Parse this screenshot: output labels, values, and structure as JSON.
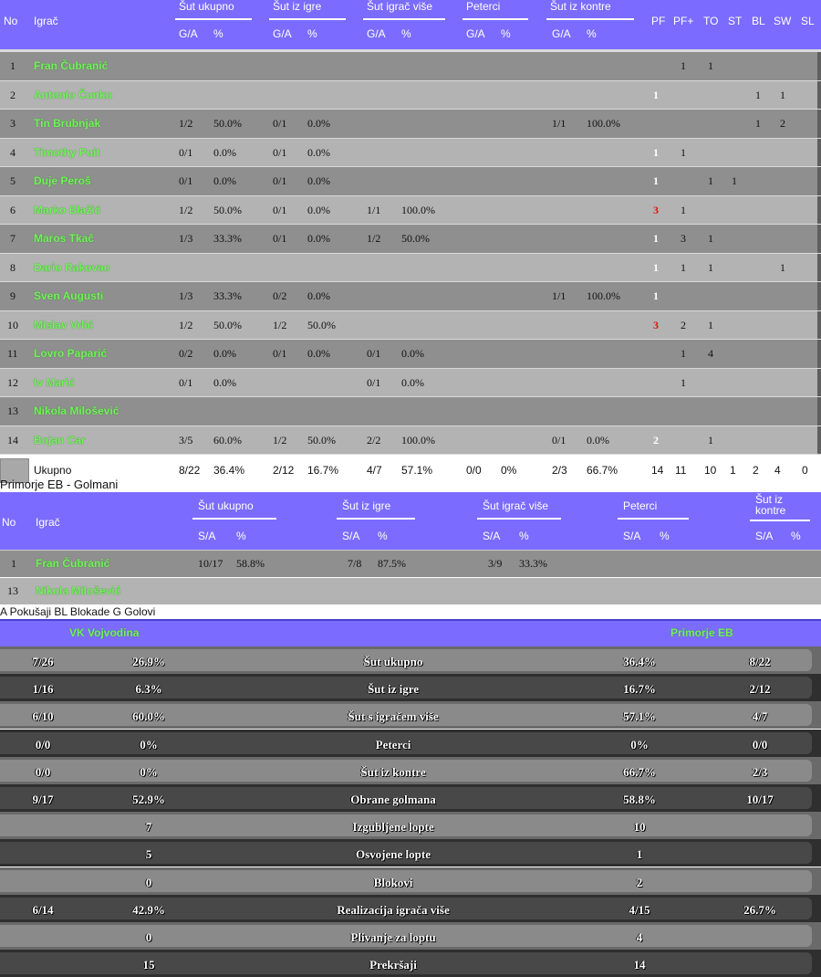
{
  "player_table": {
    "headers": {
      "no": "No",
      "player": "Igrač",
      "groups": [
        "Šut ukupno",
        "Šut iz igre",
        "Šut igrač više",
        "Peterci",
        "Šut iz kontre"
      ],
      "sub_ga": "G/A",
      "sub_pct": "%",
      "extra": [
        "PF",
        "PF+",
        "TO",
        "ST",
        "BL",
        "SW",
        "SL"
      ]
    },
    "rows": [
      {
        "no": "1",
        "name": "Fran Čubranić",
        "total_ga": "",
        "total_pct": "",
        "field_ga": "",
        "field_pct": "",
        "pp_ga": "",
        "pp_pct": "",
        "pen_ga": "",
        "pen_pct": "",
        "ca_ga": "",
        "ca_pct": "",
        "pf": "",
        "pfp": "1",
        "to": "1",
        "st": "",
        "bl": "",
        "sw": "",
        "sl": ""
      },
      {
        "no": "2",
        "name": "Antonio Čunko",
        "total_ga": "",
        "total_pct": "",
        "field_ga": "",
        "field_pct": "",
        "pp_ga": "",
        "pp_pct": "",
        "pen_ga": "",
        "pen_pct": "",
        "ca_ga": "",
        "ca_pct": "",
        "pf": "1",
        "pfp": "",
        "to": "",
        "st": "",
        "bl": "1",
        "sw": "1",
        "sl": ""
      },
      {
        "no": "3",
        "name": "Tin Brubnjak",
        "total_ga": "1/2",
        "total_pct": "50.0%",
        "field_ga": "0/1",
        "field_pct": "0.0%",
        "pp_ga": "",
        "pp_pct": "",
        "pen_ga": "",
        "pen_pct": "",
        "ca_ga": "1/1",
        "ca_pct": "100.0%",
        "pf": "",
        "pfp": "",
        "to": "",
        "st": "",
        "bl": "1",
        "sw": "2",
        "sl": ""
      },
      {
        "no": "4",
        "name": "Timothy Puit",
        "total_ga": "0/1",
        "total_pct": "0.0%",
        "field_ga": "0/1",
        "field_pct": "0.0%",
        "pp_ga": "",
        "pp_pct": "",
        "pen_ga": "",
        "pen_pct": "",
        "ca_ga": "",
        "ca_pct": "",
        "pf": "1",
        "pfp": "1",
        "to": "",
        "st": "",
        "bl": "",
        "sw": "",
        "sl": ""
      },
      {
        "no": "5",
        "name": "Duje Peroš",
        "total_ga": "0/1",
        "total_pct": "0.0%",
        "field_ga": "0/1",
        "field_pct": "0.0%",
        "pp_ga": "",
        "pp_pct": "",
        "pen_ga": "",
        "pen_pct": "",
        "ca_ga": "",
        "ca_pct": "",
        "pf": "1",
        "pfp": "",
        "to": "1",
        "st": "1",
        "bl": "",
        "sw": "",
        "sl": ""
      },
      {
        "no": "6",
        "name": "Marko Blažić",
        "total_ga": "1/2",
        "total_pct": "50.0%",
        "field_ga": "0/1",
        "field_pct": "0.0%",
        "pp_ga": "1/1",
        "pp_pct": "100.0%",
        "pen_ga": "",
        "pen_pct": "",
        "ca_ga": "",
        "ca_pct": "",
        "pf": "3",
        "pf_red": true,
        "pfp": "1",
        "to": "",
        "st": "",
        "bl": "",
        "sw": "",
        "sl": ""
      },
      {
        "no": "7",
        "name": "Maros Tkač",
        "total_ga": "1/3",
        "total_pct": "33.3%",
        "field_ga": "0/1",
        "field_pct": "0.0%",
        "pp_ga": "1/2",
        "pp_pct": "50.0%",
        "pen_ga": "",
        "pen_pct": "",
        "ca_ga": "",
        "ca_pct": "",
        "pf": "1",
        "pfp": "3",
        "to": "1",
        "st": "",
        "bl": "",
        "sw": "",
        "sl": ""
      },
      {
        "no": "8",
        "name": "Dario Rakovac",
        "total_ga": "",
        "total_pct": "",
        "field_ga": "",
        "field_pct": "",
        "pp_ga": "",
        "pp_pct": "",
        "pen_ga": "",
        "pen_pct": "",
        "ca_ga": "",
        "ca_pct": "",
        "pf": "1",
        "pfp": "1",
        "to": "1",
        "st": "",
        "bl": "",
        "sw": "1",
        "sl": ""
      },
      {
        "no": "9",
        "name": "Sven Augusti",
        "total_ga": "1/3",
        "total_pct": "33.3%",
        "field_ga": "0/2",
        "field_pct": "0.0%",
        "pp_ga": "",
        "pp_pct": "",
        "pen_ga": "",
        "pen_pct": "",
        "ca_ga": "1/1",
        "ca_pct": "100.0%",
        "pf": "1",
        "pfp": "",
        "to": "",
        "st": "",
        "bl": "",
        "sw": "",
        "sl": ""
      },
      {
        "no": "10",
        "name": "Mislav Vrlić",
        "total_ga": "1/2",
        "total_pct": "50.0%",
        "field_ga": "1/2",
        "field_pct": "50.0%",
        "pp_ga": "",
        "pp_pct": "",
        "pen_ga": "",
        "pen_pct": "",
        "ca_ga": "",
        "ca_pct": "",
        "pf": "3",
        "pf_red": true,
        "pfp": "2",
        "to": "1",
        "st": "",
        "bl": "",
        "sw": "",
        "sl": ""
      },
      {
        "no": "11",
        "name": "Lovro Paparić",
        "total_ga": "0/2",
        "total_pct": "0.0%",
        "field_ga": "0/1",
        "field_pct": "0.0%",
        "pp_ga": "0/1",
        "pp_pct": "0.0%",
        "pen_ga": "",
        "pen_pct": "",
        "ca_ga": "",
        "ca_pct": "",
        "pf": "",
        "pfp": "1",
        "to": "4",
        "st": "",
        "bl": "",
        "sw": "",
        "sl": ""
      },
      {
        "no": "12",
        "name": "Iv Marić",
        "total_ga": "0/1",
        "total_pct": "0.0%",
        "field_ga": "",
        "field_pct": "",
        "pp_ga": "0/1",
        "pp_pct": "0.0%",
        "pen_ga": "",
        "pen_pct": "",
        "ca_ga": "",
        "ca_pct": "",
        "pf": "",
        "pfp": "1",
        "to": "",
        "st": "",
        "bl": "",
        "sw": "",
        "sl": ""
      },
      {
        "no": "13",
        "name": "Nikola Milošević",
        "total_ga": "",
        "total_pct": "",
        "field_ga": "",
        "field_pct": "",
        "pp_ga": "",
        "pp_pct": "",
        "pen_ga": "",
        "pen_pct": "",
        "ca_ga": "",
        "ca_pct": "",
        "pf": "",
        "pfp": "",
        "to": "",
        "st": "",
        "bl": "",
        "sw": "",
        "sl": ""
      },
      {
        "no": "14",
        "name": "Bojan Car",
        "total_ga": "3/5",
        "total_pct": "60.0%",
        "field_ga": "1/2",
        "field_pct": "50.0%",
        "pp_ga": "2/2",
        "pp_pct": "100.0%",
        "pen_ga": "",
        "pen_pct": "",
        "ca_ga": "0/1",
        "ca_pct": "0.0%",
        "pf": "2",
        "pfp": "",
        "to": "1",
        "st": "",
        "bl": "",
        "sw": "",
        "sl": ""
      }
    ],
    "total": {
      "label": "Ukupno",
      "total_ga": "8/22",
      "total_pct": "36.4%",
      "field_ga": "2/12",
      "field_pct": "16.7%",
      "pp_ga": "4/7",
      "pp_pct": "57.1%",
      "pen_ga": "0/0",
      "pen_pct": "0%",
      "ca_ga": "2/3",
      "ca_pct": "66.7%",
      "pf": "14",
      "pfp": "11",
      "to": "10",
      "st": "1",
      "bl": "2",
      "sw": "4",
      "sl": "0"
    }
  },
  "goalkeepers": {
    "title": "Primorje EB - Golmani",
    "headers": {
      "no": "No",
      "player": "Igrač",
      "groups": [
        "Šut ukupno",
        "Šut iz igre",
        "Šut igrač više",
        "Peterci",
        "Šut iz kontre"
      ],
      "sub_sa": "S/A",
      "sub_pct": "%"
    },
    "rows": [
      {
        "no": "1",
        "name": "Fran Čubranić",
        "total": "10/17",
        "total_pct": "58.8%",
        "field": "7/8",
        "field_pct": "87.5%",
        "pp": "3/9",
        "pp_pct": "33.3%"
      },
      {
        "no": "13",
        "name": "Nikola Milošević",
        "total": "",
        "total_pct": "",
        "field": "",
        "field_pct": "",
        "pp": "",
        "pp_pct": ""
      }
    ]
  },
  "legend": "A Pokušaji   BL Blokade   G Golovi",
  "comparison": {
    "team_left": "VK Vojvodina",
    "team_right": "Primorje EB",
    "rows": [
      {
        "l1": "7/26",
        "l2": "26.9%",
        "label": "Šut ukupno",
        "r1": "36.4%",
        "r2": "8/22"
      },
      {
        "l1": "1/16",
        "l2": "6.3%",
        "label": "Šut iz igre",
        "r1": "16.7%",
        "r2": "2/12"
      },
      {
        "l1": "6/10",
        "l2": "60.0%",
        "label": "Šut s igračem više",
        "r1": "57.1%",
        "r2": "4/7"
      },
      {
        "l1": "0/0",
        "l2": "0%",
        "label": "Peterci",
        "r1": "0%",
        "r2": "0/0"
      },
      {
        "l1": "0/0",
        "l2": "0%",
        "label": "Šut iz kontre",
        "r1": "66.7%",
        "r2": "2/3"
      },
      {
        "l1": "9/17",
        "l2": "52.9%",
        "label": "Obrane golmana",
        "r1": "58.8%",
        "r2": "10/17"
      },
      {
        "l1": "",
        "l2": "7",
        "label": "Izgubljene lopte",
        "r1": "10",
        "r2": ""
      },
      {
        "l1": "",
        "l2": "5",
        "label": "Osvojene lopte",
        "r1": "1",
        "r2": ""
      },
      {
        "l1": "",
        "l2": "0",
        "label": "Blokovi",
        "r1": "2",
        "r2": ""
      },
      {
        "l1": "6/14",
        "l2": "42.9%",
        "label": "Realizacija igrača više",
        "r1": "4/15",
        "r2": "26.7%"
      },
      {
        "l1": "",
        "l2": "0",
        "label": "Plivanje za loptu",
        "r1": "4",
        "r2": ""
      },
      {
        "l1": "",
        "l2": "15",
        "label": "Prekršaji",
        "r1": "14",
        "r2": ""
      }
    ]
  },
  "colors": {
    "header_purple": "#7b6cff",
    "name_green": "#74f25e",
    "foul_red": "#e01010"
  }
}
